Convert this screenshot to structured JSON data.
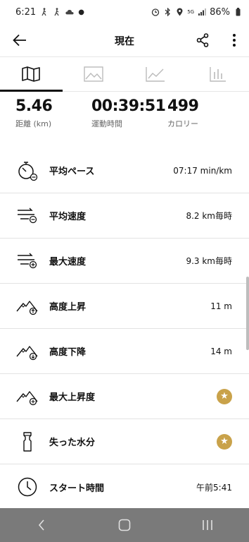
{
  "status_bar": {
    "time": "6:21",
    "battery": "86%",
    "network": "5G"
  },
  "app_bar": {
    "title": "現在"
  },
  "tabs": [
    {
      "name": "map",
      "icon": "map-icon"
    },
    {
      "name": "photo",
      "icon": "image-icon"
    },
    {
      "name": "chart",
      "icon": "line-chart-icon"
    },
    {
      "name": "bar",
      "icon": "bar-chart-icon"
    }
  ],
  "stats": {
    "distance": {
      "value": "5.46",
      "label": "距離 (km)"
    },
    "duration": {
      "value": "00:39:51",
      "label": "運動時間"
    },
    "calories": {
      "value": "499",
      "label": "カロリー"
    }
  },
  "rows": [
    {
      "label": "平均ペース",
      "value": "07:17 min/km",
      "icon": "stopwatch-icon"
    },
    {
      "label": "平均速度",
      "value": "8.2 km毎時",
      "icon": "speed-lines-icon"
    },
    {
      "label": "最大速度",
      "value": "9.3 km毎時",
      "icon": "max-speed-icon"
    },
    {
      "label": "高度上昇",
      "value": "11 m",
      "icon": "elevation-up-icon"
    },
    {
      "label": "高度下降",
      "value": "14 m",
      "icon": "elevation-down-icon"
    },
    {
      "label": "最大上昇度",
      "value": "",
      "icon": "max-elevation-icon",
      "badge": "star"
    },
    {
      "label": "失った水分",
      "value": "",
      "icon": "water-bottle-icon",
      "badge": "star"
    },
    {
      "label": "スタート時間",
      "value": "午前5:41",
      "icon": "clock-icon"
    }
  ]
}
